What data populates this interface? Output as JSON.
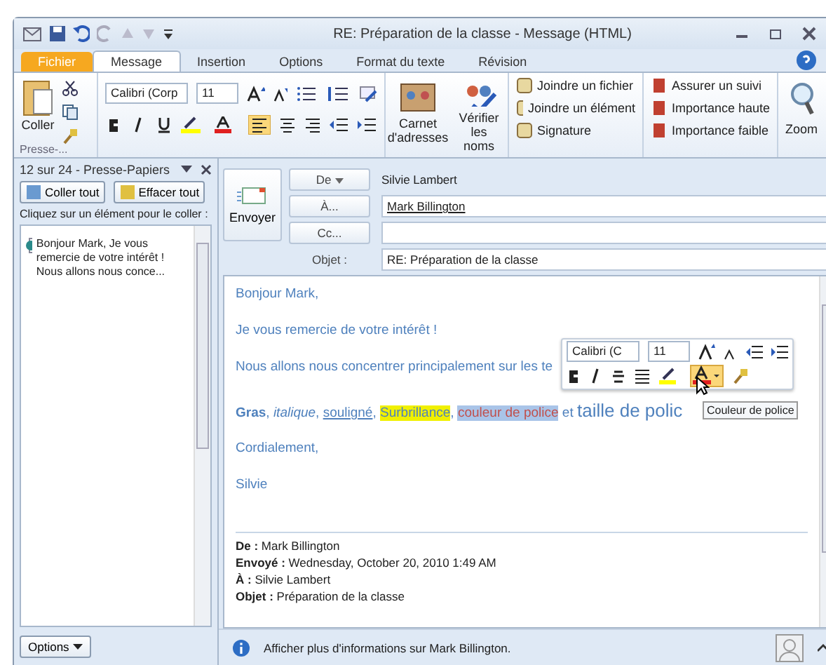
{
  "window": {
    "title": "RE: Préparation de la classe  -  Message (HTML)"
  },
  "tabs": [
    {
      "label": "Fichier",
      "kind": "file",
      "selected": false
    },
    {
      "label": "Message",
      "kind": "tab",
      "selected": true
    },
    {
      "label": "Insertion",
      "kind": "tab",
      "selected": false
    },
    {
      "label": "Options",
      "kind": "tab",
      "selected": false
    },
    {
      "label": "Format du texte",
      "kind": "tab",
      "selected": false
    },
    {
      "label": "Révision",
      "kind": "tab",
      "selected": false
    }
  ],
  "ribbon": {
    "paste": "Coller",
    "clipboard_group": "Presse-...",
    "font": "Calibri (Corp",
    "size": "11",
    "names": [
      "Carnet d'adresses",
      "Vérifier les noms"
    ],
    "include": [
      "Joindre un fichier",
      "Joindre un élément",
      "Signature"
    ],
    "tags": [
      "Assurer un suivi",
      "Importance haute",
      "Importance faible"
    ],
    "zoom": "Zoom"
  },
  "clipboard_pane": {
    "title": "12 sur 24 - Presse-Papiers",
    "buttons": [
      "Coller tout",
      "Effacer tout"
    ],
    "hint": "Cliquez sur un élément pour le coller :",
    "items": [
      "Bonjour Mark, Je vous remercie de votre intérêt ! Nous allons nous conce..."
    ],
    "options": "Options"
  },
  "compose": {
    "send": "Envoyer",
    "from_button": "De",
    "from": "Silvie Lambert",
    "to_button": "À...",
    "to": "Mark Billington",
    "cc_button": "Cc...",
    "subject_label": "Objet :",
    "subject": "RE: Préparation de la classe"
  },
  "body": {
    "before": [
      "Bonjour Mark,",
      "Je vous remercie de votre intérêt !",
      "Nous allons nous concentrer principalement sur les te"
    ],
    "runs": [
      {
        "text": "Gras",
        "kind": "bold"
      },
      {
        "text": ", ",
        "kind": "plain"
      },
      {
        "text": "italique",
        "kind": "italic"
      },
      {
        "text": ", ",
        "kind": "plain"
      },
      {
        "text": "souligné",
        "kind": "underline"
      },
      {
        "text": ", ",
        "kind": "plain"
      },
      {
        "text": "Surbrillance",
        "kind": "highlight"
      },
      {
        "text": ", ",
        "kind": "plain"
      },
      {
        "text": "couleur de police",
        "kind": "color",
        "selected": true
      },
      {
        "text": " et ",
        "kind": "plain"
      },
      {
        "text": "taille de polic",
        "kind": "large"
      }
    ],
    "after": [
      "Cordialement,",
      "Silvie"
    ],
    "quote": [
      {
        "label": "De :",
        "value": "Mark Billington"
      },
      {
        "label": "Envoyé :",
        "value": "Wednesday, October 20, 2010 1:49 AM"
      },
      {
        "label": "À :",
        "value": "Silvie Lambert"
      },
      {
        "label": "Objet :",
        "value": "Préparation de la classe"
      }
    ]
  },
  "mini_toolbar": {
    "font": "Calibri (C",
    "size": "11",
    "tooltip": "Couleur de police"
  },
  "status_bar": {
    "text": "Afficher plus d'informations sur Mark Billington."
  }
}
